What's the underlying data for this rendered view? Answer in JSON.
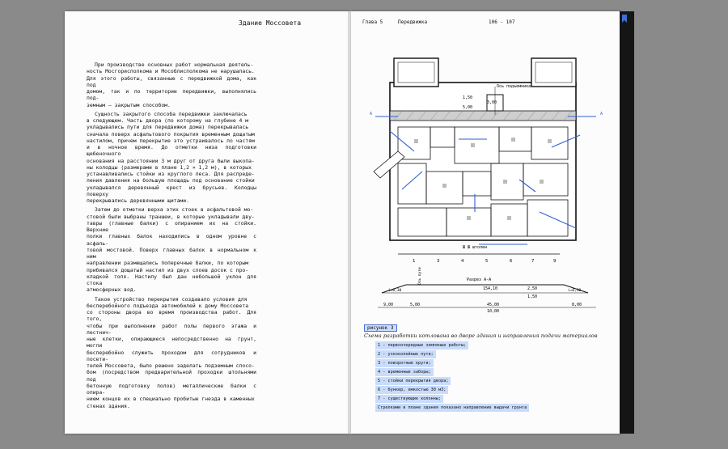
{
  "left_page": {
    "running_title": "Здание Моссовета",
    "paragraphs": [
      "При производстве основных работ нормальная деятель-\nность Мосгорисполкома и Мособлисполкома не нарушалась.\nДля этого работы, связанные с передвижкой дома, как под\nдомом, так и по территории передвижки, выполнялись под-\nземным — закрытым способом.",
      "Сущность закрытого способа передвижки заключалась\nв следующем. Часть двора (по которому на глубине 4 м\nукладывались пути для передвижки дома) перекрывалась\nсначала поверх асфальтового покрытия временным дощатым\nнастилом, причем перекрытие это устраивалось по частям\nи в ночное время. До отметки низа подготовки щебеночного\nоснования на расстоянии 3 м друг от друга были выкопа-\nны колодцы (размерами в плане 1,2 × 1,2 м), в которых\nустанавливались стойки из круглого леса. Для распреде-\nления давления на большую площадь под основание стойки\nукладывался деревянный крест из брусьев. Колодцы поверху\nперекрывались деревянными щитами.",
      "Затем до отметки верха этих стоек в асфальтовой мо-\nстовой были выбраны траншеи, в которые укладывали дву-\nтавры (главные балки) с опиранием их на стойки. Верхние\nполки главных балок находились в одном уровне с асфаль-\nтовой мостовой. Поверх главных балок в нормальном к ним\nнаправлении размещались поперечные балки, по которым\nприбивался дощатый настил из двух слоев досок с про-\nкладкой толя. Настилу был дан небольшой уклон для стока\nатмосферных вод.",
      "Такое устройство перекрытия создавало условия для\nбесперебойного подъезда автомобилей к дому Моссовета\nсо стороны двора во время производства работ. Для того,\nчтобы при выполнении работ полы первого этажа и лестнич-\nные клетки, опирающиеся непосредственно на грунт, могли\nбесперебойно служить проходом для сотрудников и посети-\nтелей Моссовета, было решено заделать подземным спосо-\nбом (посредством предварительной проходки штольнями под\nбетонную подготовку полов) металлические балки с опира-\nнием концов их в специально пробитые гнезда в каменных\nстенах здания."
    ]
  },
  "right_page": {
    "chapter": "Глава 5",
    "section": "Передвижка",
    "pages": "106 - 107",
    "drawing": {
      "label_shaft_axis": "Ось подъемника",
      "dim_150": "1,50",
      "dim_300": "3,00",
      "dim_500": "5,00",
      "marker_A": "А",
      "scale_note": "Ш Ш штолен",
      "section_label": "Разрез А-А",
      "axis_numbers": [
        "1",
        "3",
        "4",
        "5",
        "6",
        "7",
        "9"
      ],
      "axis_word": "Ось пути",
      "dim_15410": "154,10",
      "dim_250": "2,50",
      "dim_150b": "1,50",
      "slope_left": "i=0,30",
      "slope_right": "i=0,30",
      "dim_900": "9,00",
      "dim_500b": "5,00",
      "dim_4500": "45,00",
      "dim_1000": "10,00",
      "dim_800": "8,00"
    },
    "figure_label": "рисунок 3",
    "figure_title": "Схема разработки котлована во дворе здания и направления подачи материалов",
    "legend": [
      "1 - первоочередные земляные работы;",
      "2 - узкоколейные пути;",
      "3 - поворотные круги;",
      "4 - временные заборы;",
      "5 - стойки перекрытия двора;",
      "6 - бункер, емкостью 30 м3;",
      "7 - существующие колонны;",
      "Стрелками в плане здания показано направление выдачи грунта"
    ]
  }
}
